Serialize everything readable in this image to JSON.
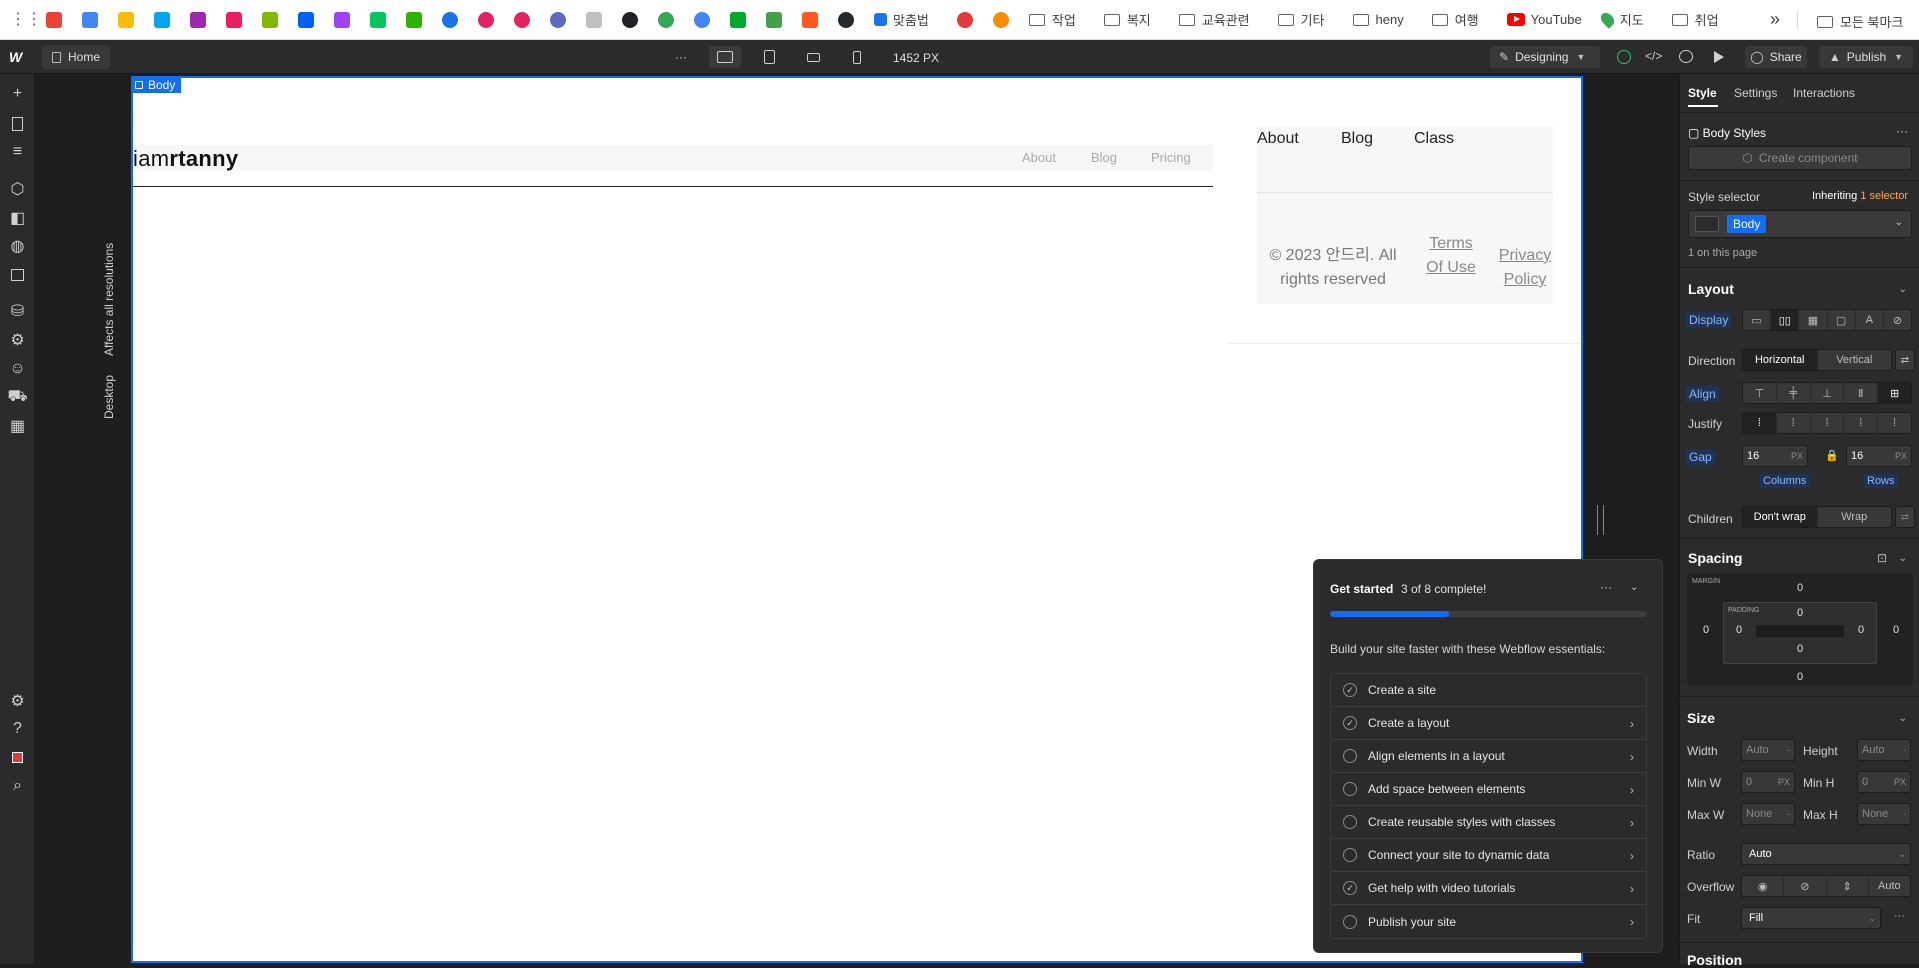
{
  "bookmarks": {
    "folders": [
      "맞춤법",
      "작업",
      "복지",
      "교육관련",
      "기타",
      "heny",
      "여행",
      "YouTube",
      "지도",
      "취업"
    ],
    "overflow": "»",
    "all_bookmarks": "모든 북마크"
  },
  "topbar": {
    "home_label": "Home",
    "more_label": "···",
    "width_label": "1452 PX",
    "designing_label": "Designing",
    "share_label": "Share",
    "publish_label": "Publish"
  },
  "canvas": {
    "body_tag": "Body",
    "affects_label": "Affects all resolutions",
    "desktop_label": "Desktop",
    "site": {
      "logo_light": "iam",
      "logo_bold": "rtanny",
      "nav_links": [
        "About",
        "Blog",
        "Pricing"
      ],
      "footer_links": [
        "About",
        "Blog",
        "Class"
      ],
      "copyright": "© 2023 안드리. All rights reserved",
      "terms": "Terms Of Use",
      "privacy": "Privacy Policy"
    }
  },
  "get_started": {
    "title": "Get started",
    "progress_text": "3 of 8 complete!",
    "progress": 0.375,
    "description": "Build your site faster with these Webflow essentials:",
    "items": [
      {
        "label": "Create a site",
        "done": true
      },
      {
        "label": "Create a layout",
        "done": true
      },
      {
        "label": "Align elements in a layout",
        "done": false
      },
      {
        "label": "Add space between elements",
        "done": false
      },
      {
        "label": "Create reusable styles with classes",
        "done": false
      },
      {
        "label": "Connect your site to dynamic data",
        "done": false
      },
      {
        "label": "Get help with video tutorials",
        "done": true
      },
      {
        "label": "Publish your site",
        "done": false
      }
    ]
  },
  "right_panel": {
    "tabs": [
      "Style",
      "Settings",
      "Interactions"
    ],
    "body_styles": "Body Styles",
    "create_component": "Create component",
    "style_selector": "Style selector",
    "inheriting": "Inheriting",
    "inheriting_count": "1 selector",
    "selector_pill": "Body",
    "on_page": "1 on this page",
    "layout": {
      "title": "Layout",
      "display_label": "Display",
      "direction_label": "Direction",
      "direction_options": [
        "Horizontal",
        "Vertical"
      ],
      "align_label": "Align",
      "justify_label": "Justify",
      "gap_label": "Gap",
      "gap_columns": "16",
      "gap_rows": "16",
      "gap_unit": "PX",
      "columns_label": "Columns",
      "rows_label": "Rows",
      "children_label": "Children",
      "children_options": [
        "Don't wrap",
        "Wrap"
      ]
    },
    "spacing": {
      "title": "Spacing",
      "margin_label": "MARGIN",
      "padding_label": "PADDING",
      "margin": {
        "top": "0",
        "right": "0",
        "bottom": "0",
        "left": "0"
      },
      "padding": {
        "top": "0",
        "right": "0",
        "bottom": "0",
        "left": "0"
      }
    },
    "size": {
      "title": "Size",
      "width_label": "Width",
      "height_label": "Height",
      "width": "Auto",
      "height": "Auto",
      "minw_label": "Min W",
      "minh_label": "Min H",
      "minw": "0",
      "minh": "0",
      "maxw_label": "Max W",
      "maxh_label": "Max H",
      "maxw": "None",
      "maxh": "None",
      "unit_px": "PX",
      "unit_dash": "-",
      "ratio_label": "Ratio",
      "ratio": "Auto",
      "overflow_label": "Overflow",
      "overflow_auto": "Auto",
      "fit_label": "Fit",
      "fit": "Fill"
    },
    "position_title": "Position"
  }
}
